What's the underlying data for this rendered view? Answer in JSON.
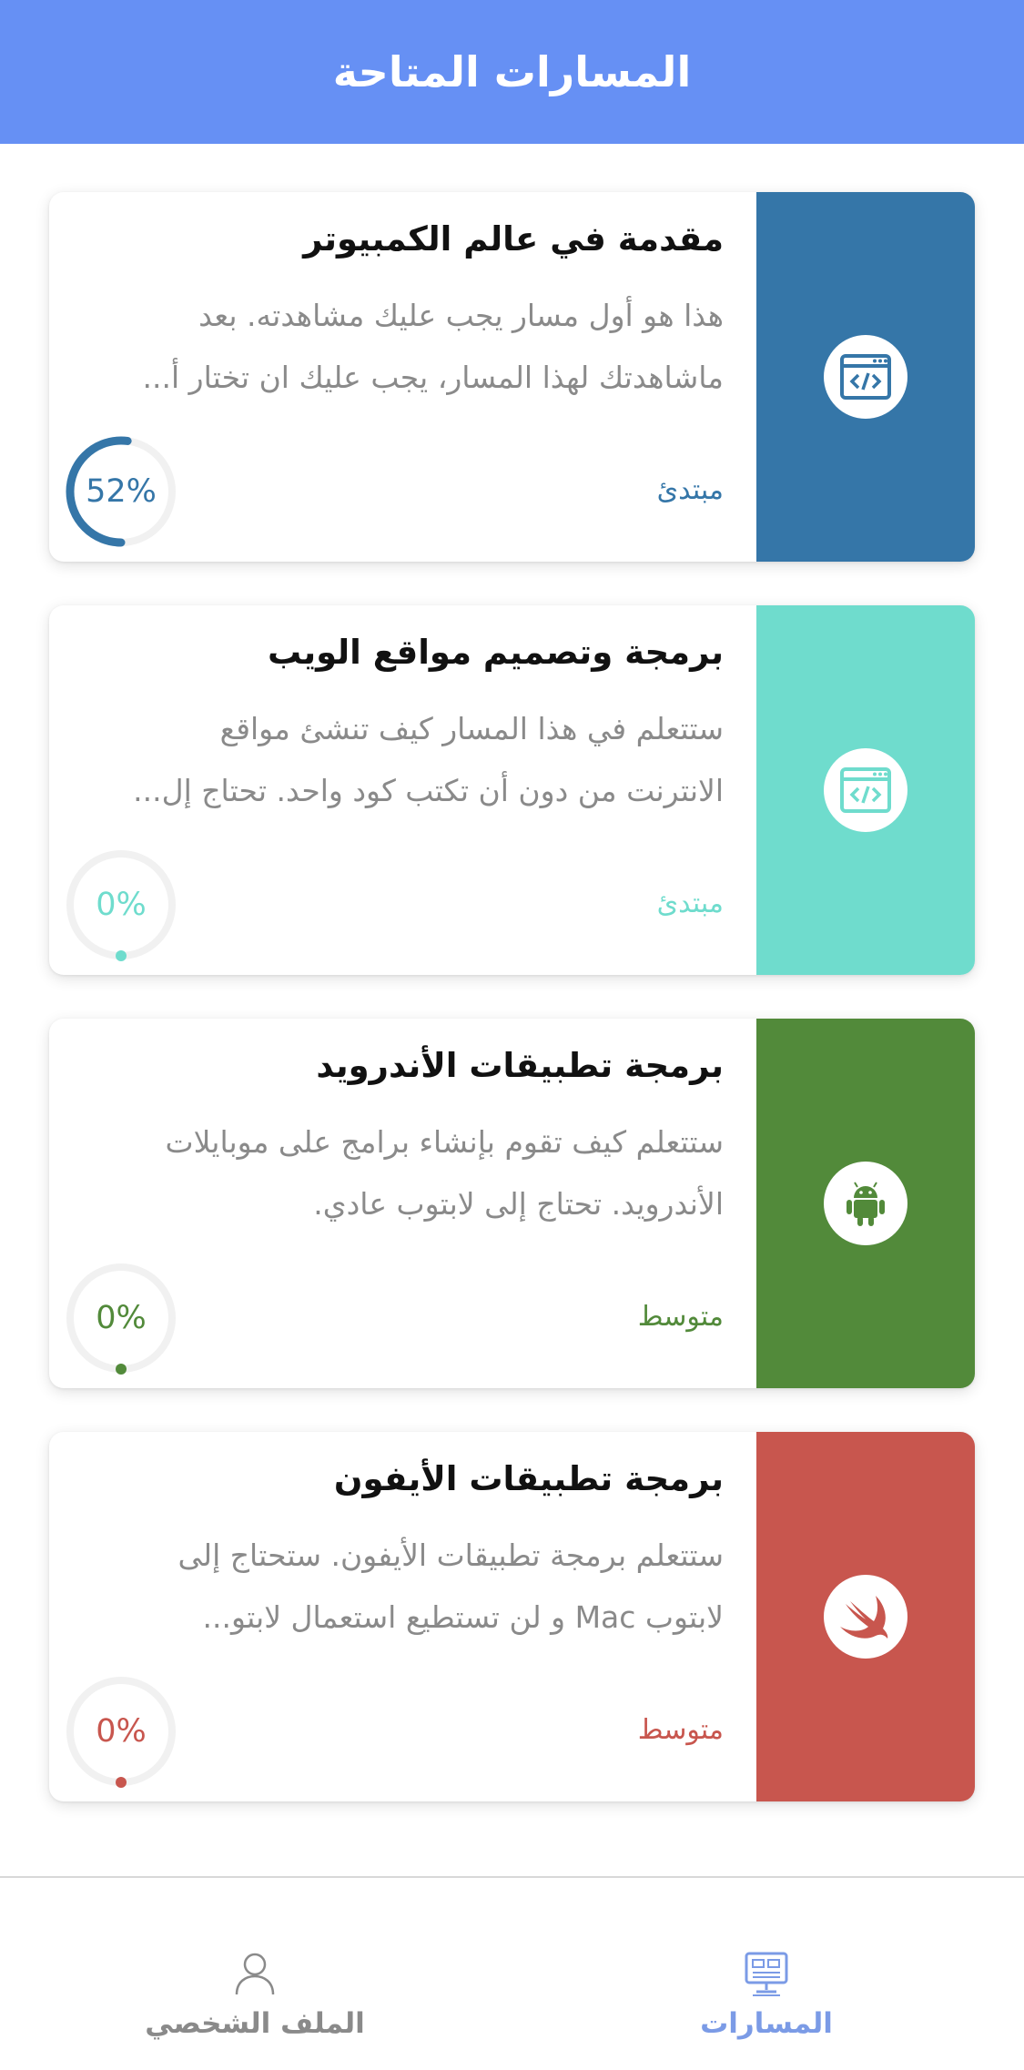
{
  "header": {
    "title": "المسارات المتاحة"
  },
  "courses": [
    {
      "title": "مقدمة في عالم الكمبيوتر",
      "desc_line1": "هذا هو أول مسار يجب عليك مشاهدته. بعد",
      "desc_line2": "ماشاهدتك لهذا المسار، يجب عليك ان تختار أ...",
      "level": "مبتدئ",
      "progress_text": "52%",
      "progress": 0.52,
      "color": "#3576a8",
      "icon": "code-window-icon"
    },
    {
      "title": "برمجة وتصميم مواقع الويب",
      "desc_line1": "ستتعلم في هذا المسار كيف تنشئ مواقع",
      "desc_line2": "الانترنت من دون أن تكتب كود واحد. تحتاج إل...",
      "level": "مبتدئ",
      "progress_text": "0%",
      "progress": 0,
      "color": "#6fdccd",
      "icon": "code-window-icon"
    },
    {
      "title": "برمجة تطبيقات الأندرويد",
      "desc_line1": "ستتعلم  كيف تقوم بإنشاء برامج على موبايلات",
      "desc_line2": "الأندرويد. تحتاج إلى لابتوب عادي.",
      "level": "متوسط",
      "progress_text": "0%",
      "progress": 0,
      "color": "#528a3a",
      "icon": "android-icon"
    },
    {
      "title": "برمجة تطبيقات الأيفون",
      "desc_line1": " ستتعلم برمجة تطبيقات الأيفون. ستحتاج إلى",
      "desc_line2": "لابتوب Mac  و لن تستطيع استعمال لابتو...",
      "level": "متوسط",
      "progress_text": "0%",
      "progress": 0,
      "color": "#c8564e",
      "icon": "swift-icon"
    }
  ],
  "tabbar": {
    "tracks": {
      "label": "المسارات",
      "icon": "monitor-icon",
      "color": "#7b9be6"
    },
    "profile": {
      "label": "الملف الشخصي",
      "icon": "user-icon",
      "color": "#8a8a8a"
    }
  }
}
